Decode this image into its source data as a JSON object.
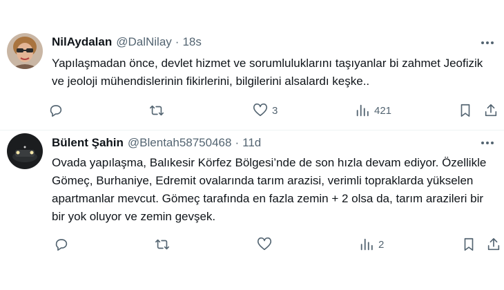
{
  "tweets": [
    {
      "name": "NilAydalan",
      "handle": "@DalNilay",
      "separator": "·",
      "time": "18s",
      "text": "Yapılaşmadan önce, devlet hizmet ve sorumluluklarını taşıyanlar bi zahmet Jeofizik ve jeoloji mühendislerinin fikirlerini, bilgilerini alsalardı keşke..",
      "reply_count": "",
      "retweet_count": "",
      "like_count": "3",
      "view_count": "421"
    },
    {
      "name": "Bülent Şahin",
      "handle": "@Blentah58750468",
      "separator": "·",
      "time": "11d",
      "text": "Ovada yapılaşma, Balıkesir Körfez Bölgesi’nde de son hızla devam ediyor. Özellikle Gömeç, Burhaniye, Edremit ovalarında tarım arazisi, verimli topraklarda yükselen apartmanlar mevcut. Gömeç tarafında en fazla zemin + 2 olsa da, tarım arazileri bir bir yok oluyor ve zemin gevşek.",
      "reply_count": "",
      "retweet_count": "",
      "like_count": "",
      "view_count": "2"
    }
  ],
  "icons": {
    "more": "more-dots-icon",
    "reply": "reply-icon",
    "retweet": "retweet-icon",
    "like": "heart-icon",
    "views": "views-icon",
    "bookmark": "bookmark-icon",
    "share": "share-icon"
  },
  "colors": {
    "text": "#0f1419",
    "secondary": "#536471",
    "divider": "#eff3f4"
  }
}
